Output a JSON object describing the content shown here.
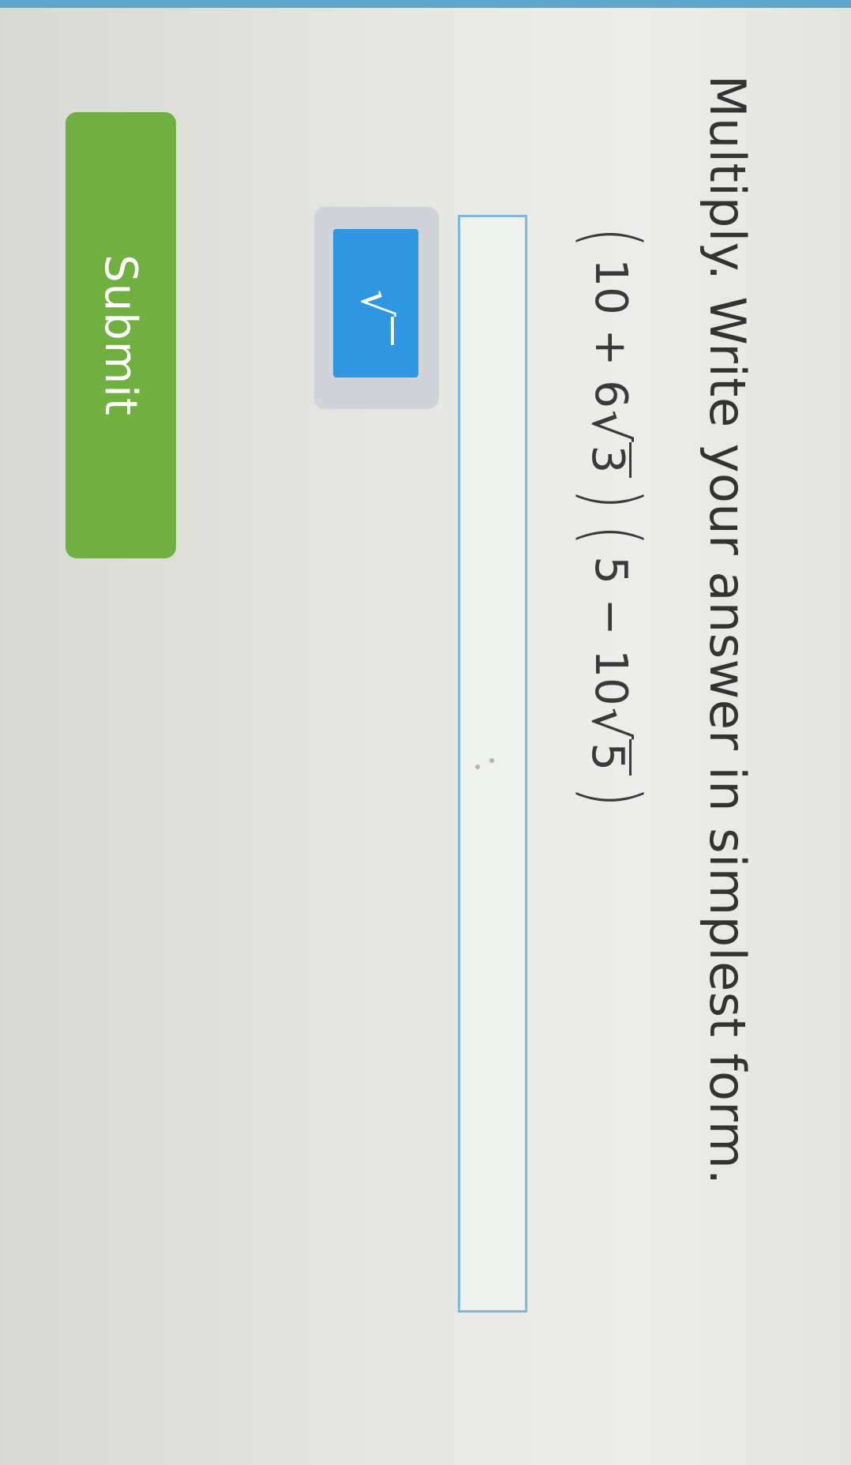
{
  "instruction": "Multiply. Write your answer in simplest form.",
  "problem": {
    "term1_a": "10 + 6",
    "term1_radicand": "3",
    "term2_a": "5 − 10",
    "term2_radicand": "5"
  },
  "answer": {
    "value": "",
    "placeholder": ""
  },
  "toolbar": {
    "sqrt_icon": "sqrt-icon",
    "sqrt_glyph": "√"
  },
  "submit_label": "Submit",
  "colors": {
    "answer_border": "#7db8df",
    "sqrt_button": "#2f97e2",
    "submit_button": "#6fb040"
  }
}
